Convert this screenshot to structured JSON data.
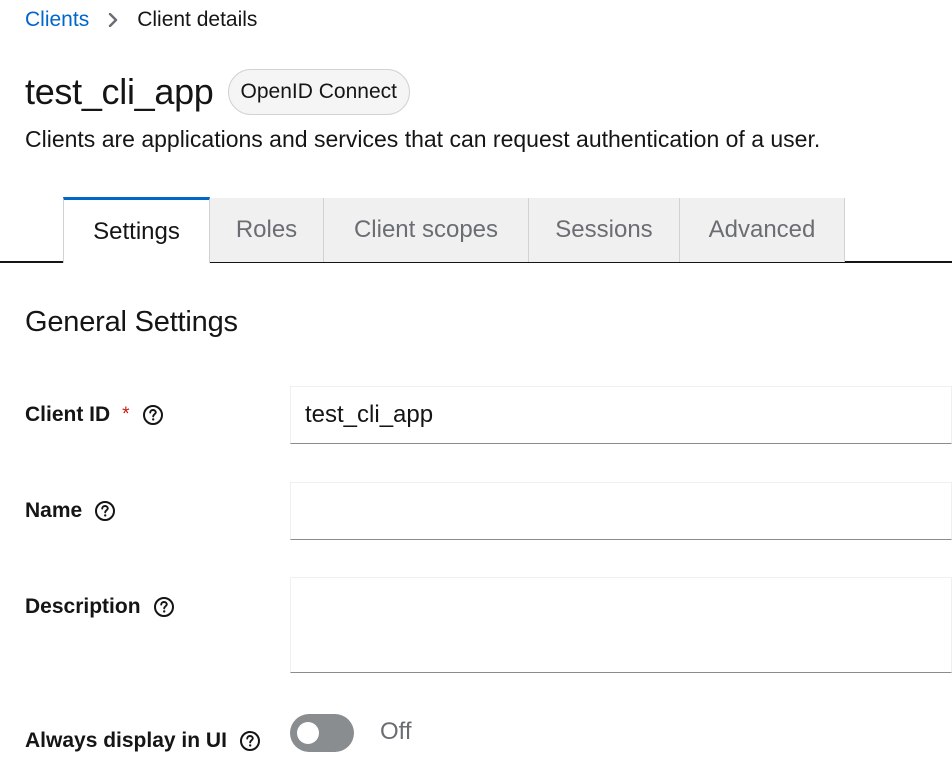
{
  "breadcrumb": {
    "parent": "Clients",
    "current": "Client details"
  },
  "header": {
    "title": "test_cli_app",
    "badge": "OpenID Connect",
    "description": "Clients are applications and services that can request authentication of a user."
  },
  "tabs": [
    {
      "label": "Settings",
      "active": true
    },
    {
      "label": "Roles",
      "active": false
    },
    {
      "label": "Client scopes",
      "active": false
    },
    {
      "label": "Sessions",
      "active": false
    },
    {
      "label": "Advanced",
      "active": false
    }
  ],
  "section": {
    "title": "General Settings"
  },
  "form": {
    "client_id": {
      "label": "Client ID",
      "required_mark": "*",
      "value": "test_cli_app"
    },
    "name": {
      "label": "Name",
      "value": ""
    },
    "description": {
      "label": "Description",
      "value": ""
    },
    "always_display": {
      "label": "Always display in UI",
      "state_text": "Off",
      "on": false
    }
  },
  "colors": {
    "link": "#0066cc",
    "active_tab_border": "#0066cc",
    "required": "#c9190b",
    "toggle_off": "#8a8d90"
  },
  "icons": {
    "breadcrumb_separator": "chevron-right-icon",
    "help": "question-circle-icon"
  }
}
